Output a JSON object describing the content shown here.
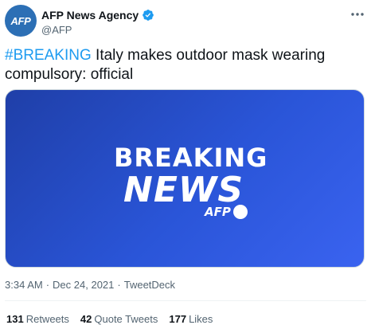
{
  "account": {
    "avatar_text": "AFP",
    "display_name": "AFP News Agency",
    "handle": "@AFP"
  },
  "tweet": {
    "hashtag": "#BREAKING",
    "body": " Italy makes outdoor mask wearing compulsory: official"
  },
  "media": {
    "headline_top": "BREAKING",
    "headline_bottom": "NEWS",
    "logo_text": "AFP"
  },
  "meta": {
    "time": "3:34 AM",
    "separator": "·",
    "date": "Dec 24, 2021",
    "source": "TweetDeck"
  },
  "stats": {
    "retweets_count": "131",
    "retweets_label": "Retweets",
    "quotes_count": "42",
    "quotes_label": "Quote Tweets",
    "likes_count": "177",
    "likes_label": "Likes"
  },
  "colors": {
    "accent": "#1d9bf0",
    "media_bg": "#2a55d8",
    "avatar_bg": "#2c6fb5"
  },
  "icons": {
    "verified": "verified-badge-icon",
    "more": "more-options-icon"
  }
}
